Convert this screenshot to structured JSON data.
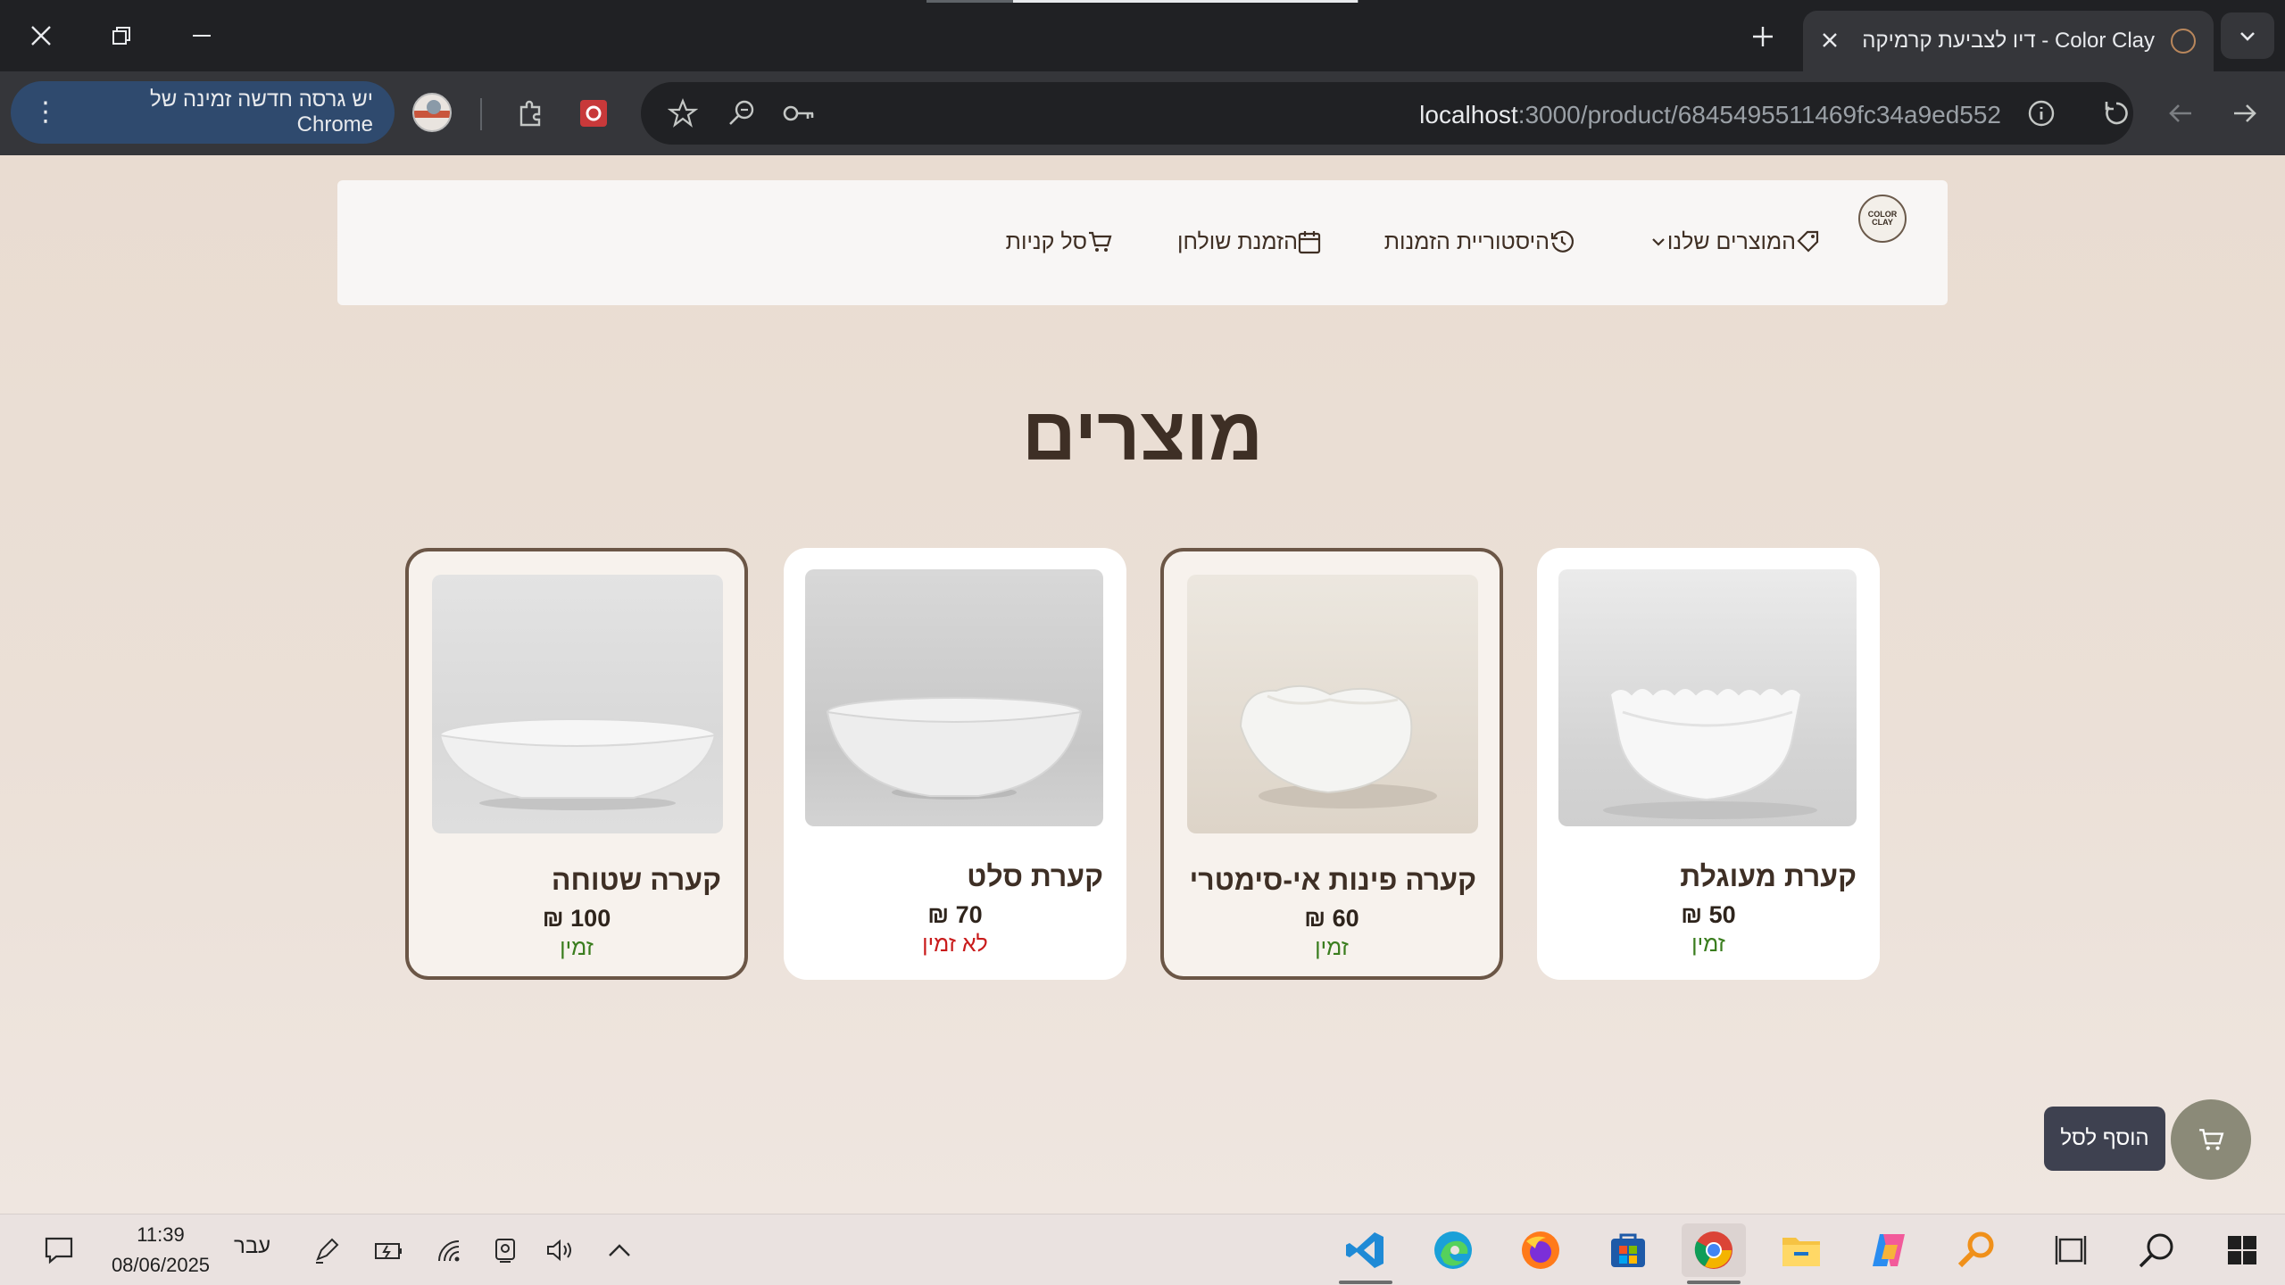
{
  "browser": {
    "tab_title": "Color Clay - דיו לצביעת קרמיקה",
    "url_host": "localhost",
    "url_path": ":3000/product/6845495511469fc34a9ed552",
    "update_label": "יש גרסה חדשה זמינה של Chrome"
  },
  "nav": {
    "logo_text": "COLOR CLAY",
    "products": "המוצרים שלנו",
    "order_history": "היסטוריית הזמנות",
    "table_booking": "הזמנת שולחן",
    "cart": "סל קניות"
  },
  "heading": "מוצרים",
  "products": [
    {
      "name": "קערת מעוגלת",
      "price": "50 ₪",
      "status": "זמין",
      "available": true,
      "selected": false
    },
    {
      "name": "קערה פינות אי-סימטרי",
      "price": "60 ₪",
      "status": "זמין",
      "available": true,
      "selected": true
    },
    {
      "name": "קערת סלט",
      "price": "70 ₪",
      "status": "לא זמין",
      "available": false,
      "selected": false
    },
    {
      "name": "קערה שטוחה",
      "price": "100 ₪",
      "status": "זמין",
      "available": true,
      "selected": true
    }
  ],
  "cart_tooltip": "הוסף לסל",
  "taskbar": {
    "time": "11:39",
    "date": "08/06/2025",
    "language": "עבר"
  },
  "colors": {
    "accent_brown": "#6b5646",
    "available_green": "#3a7d1e",
    "unavailable_red": "#c91c1c",
    "fab": "#8b8a78"
  }
}
